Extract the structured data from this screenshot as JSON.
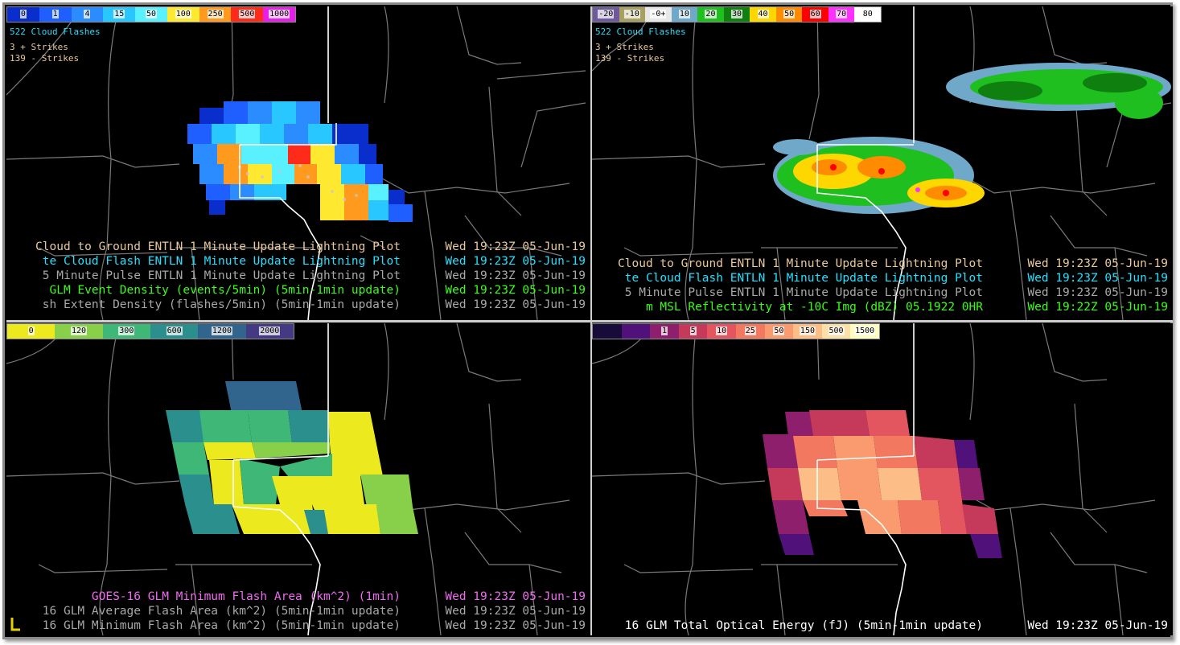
{
  "colors": {
    "tan": "#e8c89a",
    "cyan": "#22e0ff",
    "gray": "#a8a8a8",
    "green": "#39ff14",
    "magenta": "#ef6bf0",
    "white": "#ffffff",
    "border": "#cfcfcf",
    "logo": "#e8d000"
  },
  "panels": [
    {
      "id": "top-left",
      "colorbar": {
        "labels": [
          "0",
          "1",
          "4",
          "15",
          "50",
          "100",
          "250",
          "500",
          "1000"
        ],
        "colors": [
          "#0a2ecc",
          "#1f5fff",
          "#2b8cff",
          "#29c7ff",
          "#59f0ff",
          "#ffe930",
          "#ff9a1f",
          "#ff2b1a",
          "#e81ee8"
        ]
      },
      "stats": [
        {
          "text": "522 Cloud Flashes",
          "color": "#22e0ff"
        },
        {
          "text": "3 + Strikes",
          "color": "#e8c89a"
        },
        {
          "text": "139 - Strikes",
          "color": "#e8c89a"
        }
      ],
      "legend": [
        {
          "text": "Cloud to Ground ENTLN 1 Minute Update Lightning Plot",
          "date": "Wed 19:23Z 05-Jun-19",
          "color": "#e8c89a"
        },
        {
          "text": "te Cloud Flash ENTLN 1 Minute Update Lightning Plot",
          "date": "Wed 19:23Z 05-Jun-19",
          "color": "#22e0ff"
        },
        {
          "text": "5 Minute Pulse ENTLN 1 Minute Update Lightning Plot",
          "date": "Wed 19:23Z 05-Jun-19",
          "color": "#a8a8a8"
        },
        {
          "text": "GLM Event Density (events/5min) (5min-1min update)",
          "date": "Wed 19:23Z 05-Jun-19",
          "color": "#39ff14"
        },
        {
          "text": "sh Extent Density (flashes/5min) (5min-1min update)",
          "date": "Wed 19:23Z 05-Jun-19",
          "color": "#a8a8a8"
        }
      ]
    },
    {
      "id": "top-right",
      "colorbar": {
        "labels": [
          "-20",
          "-10",
          "-0+",
          "10",
          "20",
          "30",
          "40",
          "50",
          "60",
          "70",
          "80"
        ],
        "colors": [
          "#6e5a9a",
          "#a8a060",
          "#e8e8e8",
          "#6fa8c8",
          "#1fbf1f",
          "#0f7f0f",
          "#ffd700",
          "#ff8c00",
          "#ff0000",
          "#ff30ff",
          "#ffffff"
        ]
      },
      "stats": [
        {
          "text": "522 Cloud Flashes",
          "color": "#22e0ff"
        },
        {
          "text": "3 + Strikes",
          "color": "#e8c89a"
        },
        {
          "text": "139 - Strikes",
          "color": "#e8c89a"
        }
      ],
      "legend": [
        {
          "text": "Cloud to Ground ENTLN 1 Minute Update Lightning Plot",
          "date": "Wed 19:23Z 05-Jun-19",
          "color": "#e8c89a"
        },
        {
          "text": "te Cloud Flash ENTLN 1 Minute Update Lightning Plot",
          "date": "Wed 19:23Z 05-Jun-19",
          "color": "#22e0ff"
        },
        {
          "text": "5 Minute Pulse ENTLN 1 Minute Update Lightning Plot",
          "date": "Wed 19:23Z 05-Jun-19",
          "color": "#a8a8a8"
        },
        {
          "text": "m MSL Reflectivity at -10C Img (dBZ)      05.1922    0HR",
          "date": "Wed 19:22Z 05-Jun-19",
          "color": "#39ff14"
        }
      ]
    },
    {
      "id": "bottom-left",
      "colorbar": {
        "labels": [
          "0",
          "120",
          "300",
          "600",
          "1200",
          "2000"
        ],
        "colors": [
          "#ecea1e",
          "#88cf4a",
          "#3fb877",
          "#2a8f8d",
          "#31658d",
          "#443a83"
        ]
      },
      "stats": [],
      "legend": [
        {
          "text": "GOES-16 GLM Minimum Flash Area (km^2) (1min)",
          "date": "Wed 19:23Z 05-Jun-19",
          "color": "#ef6bf0"
        },
        {
          "text": "16 GLM Average Flash Area (km^2) (5min-1min update)",
          "date": "Wed 19:23Z 05-Jun-19",
          "color": "#a8a8a8"
        },
        {
          "text": "16 GLM Minimum Flash Area (km^2) (5min-1min update)",
          "date": "Wed 19:23Z 05-Jun-19",
          "color": "#a8a8a8"
        }
      ]
    },
    {
      "id": "bottom-right",
      "colorbar": {
        "labels": [
          "",
          "",
          "1",
          "5",
          "10",
          "25",
          "50",
          "150",
          "500",
          "1500"
        ],
        "colors": [
          "#160b39",
          "#50117a",
          "#8d1f6c",
          "#c53a5a",
          "#e4565f",
          "#f37860",
          "#f99a6f",
          "#fcbd87",
          "#fde0a8",
          "#fcfdbf"
        ]
      },
      "stats": [],
      "legend": [
        {
          "text": "16 GLM Total Optical Energy (fJ) (5min-1min update)",
          "date": "Wed 19:23Z 05-Jun-19",
          "color": "#ffffff"
        }
      ]
    }
  ]
}
